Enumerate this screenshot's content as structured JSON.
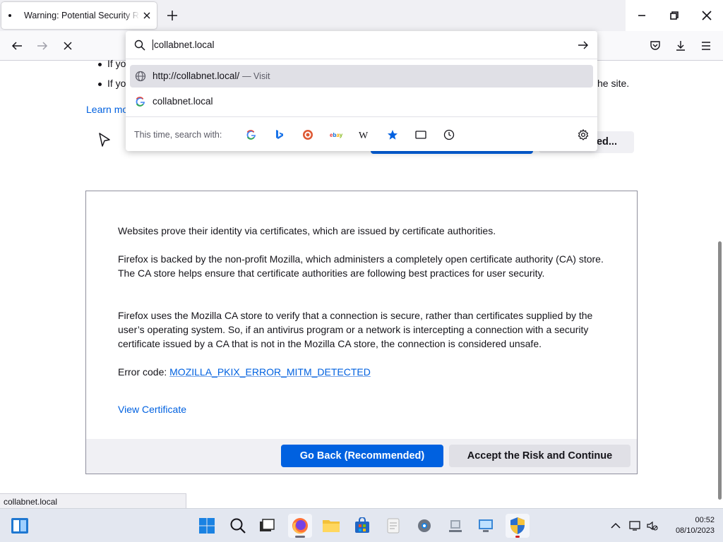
{
  "browser": {
    "tab_title": "Warning: Potential Security Risk Ahead",
    "url_value": "collabnet.local",
    "status_url": "collabnet.local"
  },
  "url_dropdown": {
    "suggestions": [
      {
        "text": "http://collabnet.local/",
        "action": "— Visit",
        "icon": "globe-icon"
      },
      {
        "text": "collabnet.local",
        "action": "",
        "icon": "google-icon"
      }
    ],
    "search_with_label": "This time, search with:",
    "engines": [
      "google",
      "bing",
      "duckduckgo",
      "ebay",
      "wikipedia",
      "bookmarks",
      "tabs",
      "history"
    ]
  },
  "page": {
    "bullet_1": "If yo",
    "bullet_2": "If yo",
    "bullet_2_tail": "he site.",
    "learn_more": "Learn mo",
    "partial_button": "ed...",
    "advanced": {
      "p1": "Websites prove their identity via certificates, which are issued by certificate authorities.",
      "p2": "Firefox is backed by the non-profit Mozilla, which administers a completely open certificate authority (CA) store. The CA store helps ensure that certificate authorities are following best practices for user security.",
      "p3": "Firefox uses the Mozilla CA store to verify that a connection is secure, rather than certificates supplied by the user’s operating system. So, if an antivirus program or a network is intercepting a connection with a security certificate issued by a CA that is not in the Mozilla CA store, the connection is considered unsafe.",
      "error_label": "Error code: ",
      "error_code": "MOZILLA_PKIX_ERROR_MITM_DETECTED",
      "view_certificate": "View Certificate",
      "go_back": "Go Back (Recommended)",
      "accept": "Accept the Risk and Continue"
    }
  },
  "taskbar": {
    "time": "00:52",
    "date": "08/10/2023"
  },
  "colors": {
    "accent": "#0061e0",
    "link": "#0061e0"
  }
}
